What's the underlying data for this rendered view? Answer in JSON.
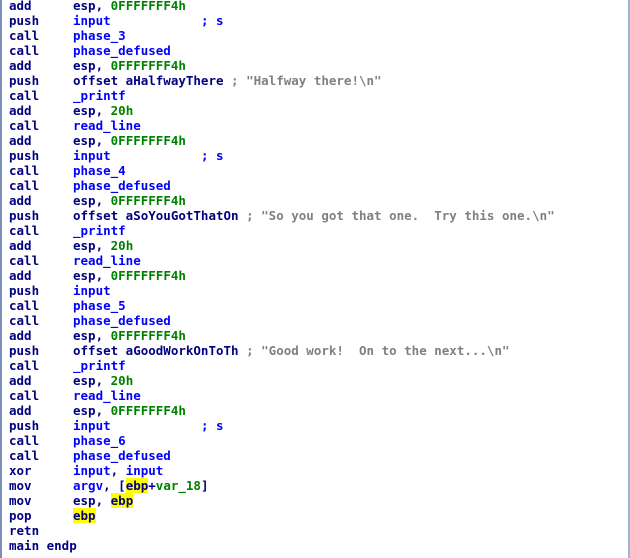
{
  "listing": [
    {
      "mnemonic": "add",
      "tokens": [
        {
          "t": "esp",
          "k": "reg"
        },
        {
          "t": ", ",
          "k": "pun"
        },
        {
          "t": "0FFFFFFF4h",
          "k": "num"
        }
      ]
    },
    {
      "mnemonic": "push",
      "tokens": [
        {
          "t": "input",
          "k": "sym"
        },
        {
          "t": "            ",
          "k": "pun"
        },
        {
          "t": "; s",
          "k": "sym"
        }
      ]
    },
    {
      "mnemonic": "call",
      "tokens": [
        {
          "t": "phase_3",
          "k": "sym"
        }
      ]
    },
    {
      "mnemonic": "call",
      "tokens": [
        {
          "t": "phase_defused",
          "k": "sym"
        }
      ]
    },
    {
      "mnemonic": "add",
      "tokens": [
        {
          "t": "esp",
          "k": "reg"
        },
        {
          "t": ", ",
          "k": "pun"
        },
        {
          "t": "0FFFFFFF4h",
          "k": "num"
        }
      ]
    },
    {
      "mnemonic": "push",
      "tokens": [
        {
          "t": "offset aHalfwayThere",
          "k": "off"
        },
        {
          "t": " ; \"Halfway there!\\n\"",
          "k": "com"
        }
      ]
    },
    {
      "mnemonic": "call",
      "tokens": [
        {
          "t": "_printf",
          "k": "sym"
        }
      ]
    },
    {
      "mnemonic": "add",
      "tokens": [
        {
          "t": "esp",
          "k": "reg"
        },
        {
          "t": ", ",
          "k": "pun"
        },
        {
          "t": "20h",
          "k": "num"
        }
      ]
    },
    {
      "mnemonic": "call",
      "tokens": [
        {
          "t": "read_line",
          "k": "sym"
        }
      ]
    },
    {
      "mnemonic": "add",
      "tokens": [
        {
          "t": "esp",
          "k": "reg"
        },
        {
          "t": ", ",
          "k": "pun"
        },
        {
          "t": "0FFFFFFF4h",
          "k": "num"
        }
      ]
    },
    {
      "mnemonic": "push",
      "tokens": [
        {
          "t": "input",
          "k": "sym"
        },
        {
          "t": "            ",
          "k": "pun"
        },
        {
          "t": "; s",
          "k": "sym"
        }
      ]
    },
    {
      "mnemonic": "call",
      "tokens": [
        {
          "t": "phase_4",
          "k": "sym"
        }
      ]
    },
    {
      "mnemonic": "call",
      "tokens": [
        {
          "t": "phase_defused",
          "k": "sym"
        }
      ]
    },
    {
      "mnemonic": "add",
      "tokens": [
        {
          "t": "esp",
          "k": "reg"
        },
        {
          "t": ", ",
          "k": "pun"
        },
        {
          "t": "0FFFFFFF4h",
          "k": "num"
        }
      ]
    },
    {
      "mnemonic": "push",
      "tokens": [
        {
          "t": "offset aSoYouGotThatOn",
          "k": "off"
        },
        {
          "t": " ; \"So you got that one.  Try this one.\\n\"",
          "k": "com"
        }
      ]
    },
    {
      "mnemonic": "call",
      "tokens": [
        {
          "t": "_printf",
          "k": "sym"
        }
      ]
    },
    {
      "mnemonic": "add",
      "tokens": [
        {
          "t": "esp",
          "k": "reg"
        },
        {
          "t": ", ",
          "k": "pun"
        },
        {
          "t": "20h",
          "k": "num"
        }
      ]
    },
    {
      "mnemonic": "call",
      "tokens": [
        {
          "t": "read_line",
          "k": "sym"
        }
      ]
    },
    {
      "mnemonic": "add",
      "tokens": [
        {
          "t": "esp",
          "k": "reg"
        },
        {
          "t": ", ",
          "k": "pun"
        },
        {
          "t": "0FFFFFFF4h",
          "k": "num"
        }
      ]
    },
    {
      "mnemonic": "push",
      "tokens": [
        {
          "t": "input",
          "k": "sym"
        }
      ]
    },
    {
      "mnemonic": "call",
      "tokens": [
        {
          "t": "phase_5",
          "k": "sym"
        }
      ]
    },
    {
      "mnemonic": "call",
      "tokens": [
        {
          "t": "phase_defused",
          "k": "sym"
        }
      ]
    },
    {
      "mnemonic": "add",
      "tokens": [
        {
          "t": "esp",
          "k": "reg"
        },
        {
          "t": ", ",
          "k": "pun"
        },
        {
          "t": "0FFFFFFF4h",
          "k": "num"
        }
      ]
    },
    {
      "mnemonic": "push",
      "tokens": [
        {
          "t": "offset aGoodWorkOnToTh",
          "k": "off"
        },
        {
          "t": " ; \"Good work!  On to the next...\\n\"",
          "k": "com"
        }
      ]
    },
    {
      "mnemonic": "call",
      "tokens": [
        {
          "t": "_printf",
          "k": "sym"
        }
      ]
    },
    {
      "mnemonic": "add",
      "tokens": [
        {
          "t": "esp",
          "k": "reg"
        },
        {
          "t": ", ",
          "k": "pun"
        },
        {
          "t": "20h",
          "k": "num"
        }
      ]
    },
    {
      "mnemonic": "call",
      "tokens": [
        {
          "t": "read_line",
          "k": "sym"
        }
      ]
    },
    {
      "mnemonic": "add",
      "tokens": [
        {
          "t": "esp",
          "k": "reg"
        },
        {
          "t": ", ",
          "k": "pun"
        },
        {
          "t": "0FFFFFFF4h",
          "k": "num"
        }
      ]
    },
    {
      "mnemonic": "push",
      "tokens": [
        {
          "t": "input",
          "k": "sym"
        },
        {
          "t": "            ",
          "k": "pun"
        },
        {
          "t": "; s",
          "k": "sym"
        }
      ]
    },
    {
      "mnemonic": "call",
      "tokens": [
        {
          "t": "phase_6",
          "k": "sym"
        }
      ]
    },
    {
      "mnemonic": "call",
      "tokens": [
        {
          "t": "phase_defused",
          "k": "sym"
        }
      ]
    },
    {
      "mnemonic": "xor",
      "tokens": [
        {
          "t": "input",
          "k": "sym"
        },
        {
          "t": ", ",
          "k": "pun"
        },
        {
          "t": "input",
          "k": "sym"
        }
      ]
    },
    {
      "mnemonic": "mov",
      "tokens": [
        {
          "t": "argv",
          "k": "sym"
        },
        {
          "t": ", [",
          "k": "pun"
        },
        {
          "t": "ebp",
          "k": "hl"
        },
        {
          "t": "+",
          "k": "pun"
        },
        {
          "t": "var_18",
          "k": "var"
        },
        {
          "t": "]",
          "k": "pun"
        }
      ]
    },
    {
      "mnemonic": "mov",
      "tokens": [
        {
          "t": "esp",
          "k": "reg"
        },
        {
          "t": ", ",
          "k": "pun"
        },
        {
          "t": "ebp",
          "k": "hl"
        }
      ]
    },
    {
      "mnemonic": "pop",
      "tokens": [
        {
          "t": "ebp",
          "k": "hl"
        }
      ]
    },
    {
      "mnemonic": "retn",
      "tokens": []
    },
    {
      "mnemonic": "main endp",
      "tokens": []
    }
  ],
  "colors": {
    "background": "#ffffff",
    "mnemonic": "#000080",
    "symbol": "#0000ff",
    "number": "#008000",
    "comment": "#808080",
    "highlight": "#ffff00"
  }
}
